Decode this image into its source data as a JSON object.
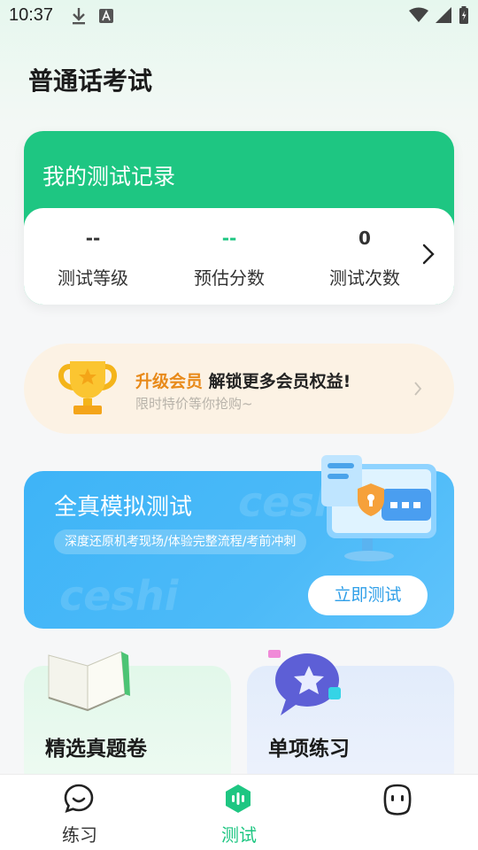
{
  "status_bar": {
    "time": "10:37"
  },
  "page": {
    "title": "普通话考试"
  },
  "record": {
    "title": "我的测试记录",
    "stats": [
      {
        "value": "--",
        "label": "测试等级"
      },
      {
        "value": "--",
        "label": "预估分数"
      },
      {
        "value": "0",
        "label": "测试次数"
      }
    ]
  },
  "vip": {
    "highlight": "升级会员",
    "text": " 解锁更多会员权益!",
    "sub": "限时特价等你抢购~"
  },
  "mock_exam": {
    "watermark": "ceshi",
    "title": "全真模拟测试",
    "tag": "深度还原机考现场/体验完整流程/考前冲刺",
    "button": "立即测试"
  },
  "cards": {
    "left_title": "精选真题卷",
    "right_title": "单项练习"
  },
  "tabs": [
    {
      "label": "练习",
      "icon": "chat-smile-icon",
      "active": false
    },
    {
      "label": "测试",
      "icon": "test-hexagon-icon",
      "active": true
    },
    {
      "label": "",
      "icon": "face-icon",
      "active": false
    }
  ],
  "colors": {
    "brand_green": "#1ec682",
    "blue": "#3eb4f7",
    "orange": "#e88a1a"
  }
}
